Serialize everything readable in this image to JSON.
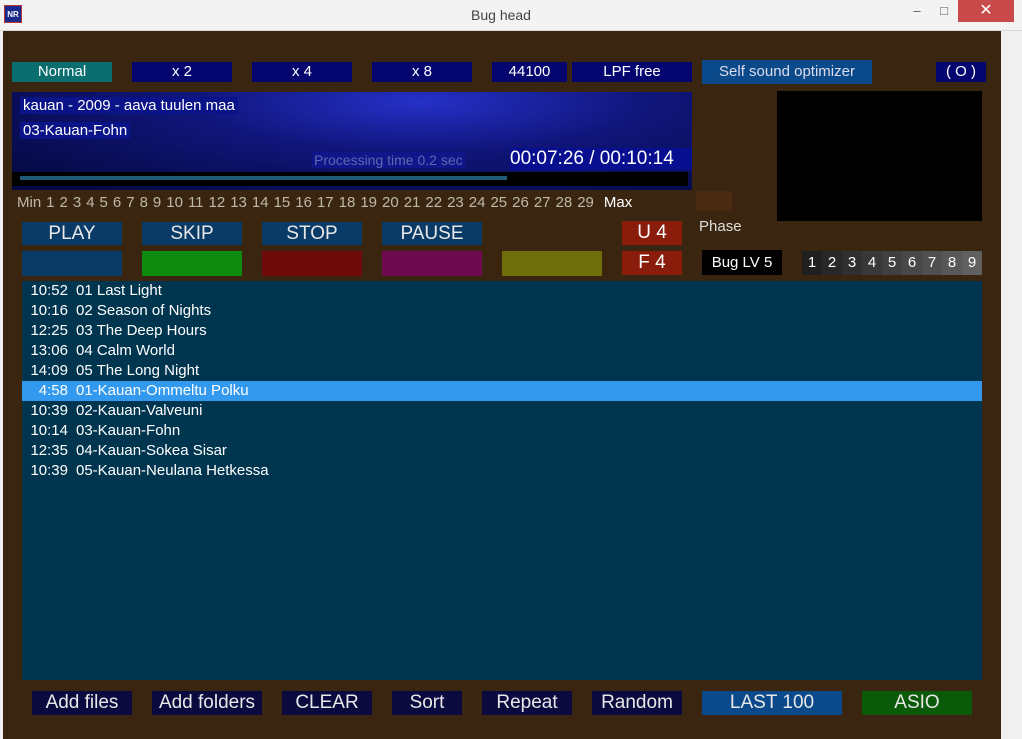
{
  "window": {
    "icon_text": "NR",
    "title": "Bug head",
    "minimize": "‒",
    "maximize": "□",
    "close": "✕"
  },
  "topbar": {
    "normal": "Normal",
    "x2": "x 2",
    "x4": "x 4",
    "x8": "x 8",
    "rate": "44100",
    "lpf": "LPF free",
    "optimizer": "Self sound optimizer",
    "o": "( O )"
  },
  "display": {
    "line1": "kauan - 2009 - aava tuulen maa",
    "line2": "03-Kauan-Fohn",
    "processing": "Processing time  0.2 sec",
    "time": "00:07:26 / 00:10:14",
    "progress": 0.72
  },
  "scale": {
    "min": "Min",
    "numbers": [
      "1",
      "2",
      "3",
      "4",
      "5",
      "6",
      "7",
      "8",
      "9",
      "10",
      "11",
      "12",
      "13",
      "14",
      "15",
      "16",
      "17",
      "18",
      "19",
      "20",
      "21",
      "22",
      "23",
      "24",
      "25",
      "26",
      "27",
      "28",
      "29"
    ],
    "max": "Max"
  },
  "phase": "Phase",
  "controls": {
    "play": "PLAY",
    "skip": "SKIP",
    "stop": "STOP",
    "pause": "PAUSE",
    "u": "U 4",
    "f": "F 4"
  },
  "swatches": [
    "#0a3a66",
    "#0e8a0e",
    "#6e0a0a",
    "#6e0a4e",
    "#6e6e0a"
  ],
  "bug_level": "Bug LV 5",
  "levels": [
    "1",
    "2",
    "3",
    "4",
    "5",
    "6",
    "7",
    "8",
    "9"
  ],
  "level_colors": [
    "#202020",
    "#282828",
    "#303030",
    "#383838",
    "#404040",
    "#484848",
    "#505050",
    "#585858",
    "#606060"
  ],
  "playlist": [
    {
      "time": "10:52",
      "title": "01 Last Light",
      "selected": false
    },
    {
      "time": "10:16",
      "title": "02 Season of Nights",
      "selected": false
    },
    {
      "time": "12:25",
      "title": "03 The Deep Hours",
      "selected": false
    },
    {
      "time": "13:06",
      "title": "04 Calm World",
      "selected": false
    },
    {
      "time": "14:09",
      "title": "05 The Long Night",
      "selected": false
    },
    {
      "time": "4:58",
      "title": "01-Kauan-Ommeltu Polku",
      "selected": true
    },
    {
      "time": "10:39",
      "title": "02-Kauan-Valveuni",
      "selected": false
    },
    {
      "time": "10:14",
      "title": "03-Kauan-Fohn",
      "selected": false
    },
    {
      "time": "12:35",
      "title": "04-Kauan-Sokea Sisar",
      "selected": false
    },
    {
      "time": "10:39",
      "title": "05-Kauan-Neulana Hetkessa",
      "selected": false
    }
  ],
  "bottom": {
    "add_files": "Add files",
    "add_folders": "Add folders",
    "clear": "CLEAR",
    "sort": "Sort",
    "repeat": "Repeat",
    "random": "Random",
    "last100": "LAST 100",
    "asio": "ASIO"
  }
}
